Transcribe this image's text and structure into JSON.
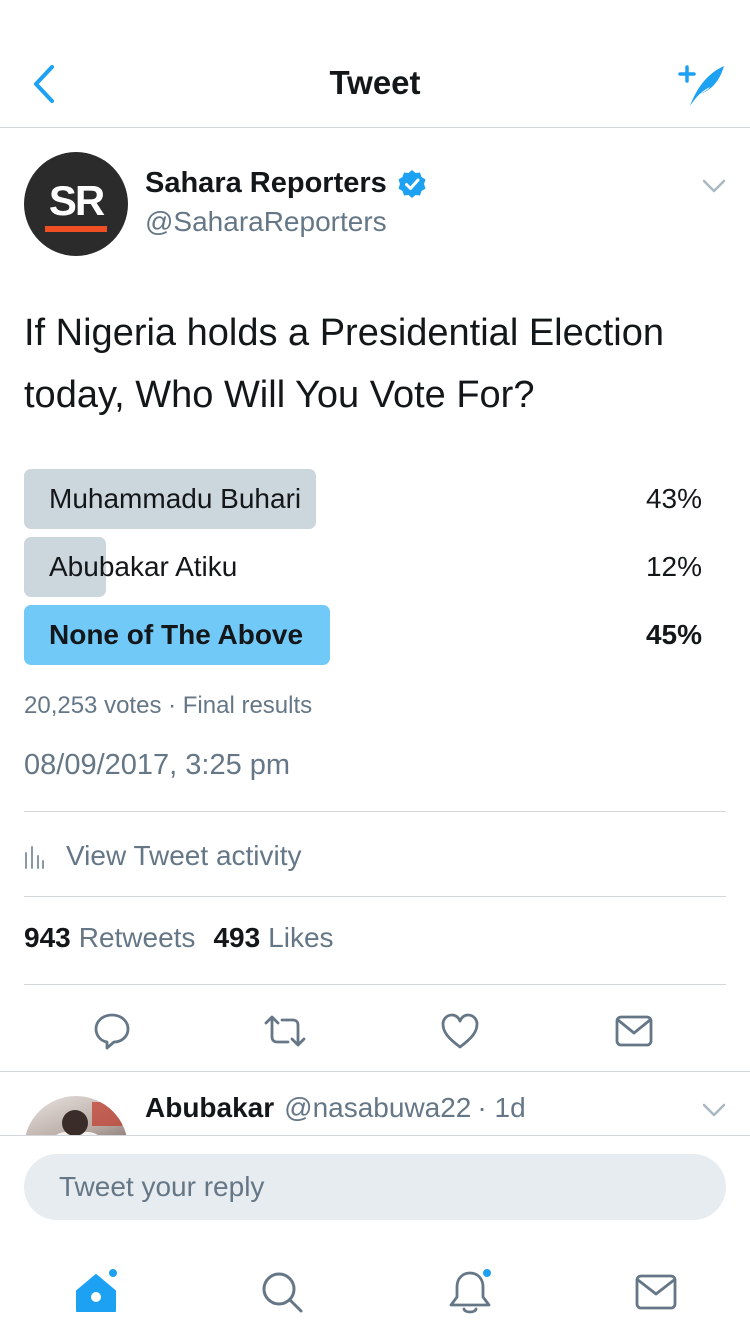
{
  "header": {
    "title": "Tweet",
    "back_icon": "chevron-left-icon",
    "compose_icon": "compose-tweet-icon",
    "accent_color": "#1da1f2"
  },
  "tweet": {
    "author_name": "Sahara Reporters",
    "author_handle": "@SaharaReporters",
    "avatar_text": "SR",
    "verified": true,
    "text": "If Nigeria holds a Presidential Election today, Who Will You Vote For?",
    "poll": {
      "options": [
        {
          "label": "Muhammadu Buhari",
          "percent_label": "43%",
          "percent": 43,
          "winner": false
        },
        {
          "label": "Abubakar Atiku",
          "percent_label": "12%",
          "percent": 12,
          "winner": false
        },
        {
          "label": "None of The Above",
          "percent_label": "45%",
          "percent": 45,
          "winner": true
        }
      ],
      "meta": "20,253 votes · Final results"
    },
    "timestamp": "08/09/2017, 3:25 pm",
    "activity_label": "View Tweet activity",
    "retweets_count": "943",
    "retweets_label": "Retweets",
    "likes_count": "493",
    "likes_label": "Likes",
    "actions": [
      "reply-icon",
      "retweet-icon",
      "like-icon",
      "share-icon"
    ]
  },
  "reply": {
    "name": "Abubakar",
    "handle": "@nasabuwa22",
    "time": "· 1d"
  },
  "composer": {
    "placeholder": "Tweet your reply"
  },
  "tabbar": {
    "items": [
      "home-icon",
      "search-icon",
      "notifications-icon",
      "messages-icon"
    ]
  }
}
